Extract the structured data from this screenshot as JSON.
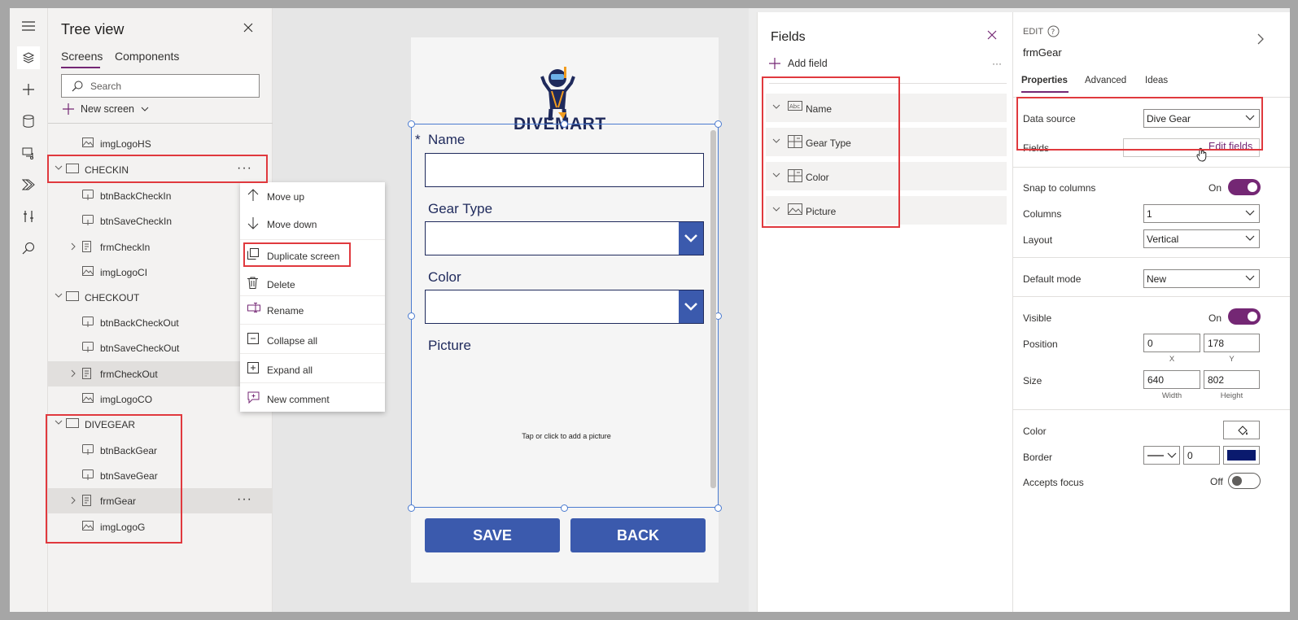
{
  "colors": {
    "accent": "#742774",
    "form_primary": "#3b5aad",
    "form_text": "#1f2a5c",
    "highlight": "#e0393e",
    "border_swatch": "#0a1a6e"
  },
  "tree": {
    "title": "Tree view",
    "tabs": [
      "Screens",
      "Components"
    ],
    "search_placeholder": "Search",
    "new_screen": "New screen",
    "nodes": [
      {
        "label": "imgLogoHS",
        "icon": "image-icon"
      },
      {
        "label": "CHECKIN",
        "icon": "screen-icon"
      },
      {
        "label": "btnBackCheckIn",
        "icon": "button-icon"
      },
      {
        "label": "btnSaveCheckIn",
        "icon": "button-icon"
      },
      {
        "label": "frmCheckIn",
        "icon": "form-icon"
      },
      {
        "label": "imgLogoCI",
        "icon": "image-icon"
      },
      {
        "label": "CHECKOUT",
        "icon": "screen-icon"
      },
      {
        "label": "btnBackCheckOut",
        "icon": "button-icon"
      },
      {
        "label": "btnSaveCheckOut",
        "icon": "button-icon"
      },
      {
        "label": "frmCheckOut",
        "icon": "form-icon"
      },
      {
        "label": "imgLogoCO",
        "icon": "image-icon"
      },
      {
        "label": "DIVEGEAR",
        "icon": "screen-icon"
      },
      {
        "label": "btnBackGear",
        "icon": "button-icon"
      },
      {
        "label": "btnSaveGear",
        "icon": "button-icon"
      },
      {
        "label": "frmGear",
        "icon": "form-icon"
      },
      {
        "label": "imgLogoG",
        "icon": "image-icon"
      }
    ],
    "more": "···"
  },
  "context_menu": {
    "items": [
      "Move up",
      "Move down",
      "Duplicate screen",
      "Delete",
      "Rename",
      "Collapse all",
      "Expand all",
      "New comment"
    ]
  },
  "canvas": {
    "logo_text": "DIVEMART",
    "required_mark": "*",
    "labels": {
      "name": "Name",
      "gear_type": "Gear Type",
      "color": "Color",
      "picture": "Picture"
    },
    "picture_hint": "Tap or click to add a picture",
    "save": "SAVE",
    "back": "BACK"
  },
  "fields": {
    "title": "Fields",
    "add_field": "Add field",
    "more": "···",
    "items": [
      {
        "label": "Name",
        "icon": "text-icon"
      },
      {
        "label": "Gear Type",
        "icon": "dropdown-field-icon"
      },
      {
        "label": "Color",
        "icon": "dropdown-field-icon"
      },
      {
        "label": "Picture",
        "icon": "image-icon"
      }
    ]
  },
  "props": {
    "edit": "EDIT",
    "name": "frmGear",
    "tabs": [
      "Properties",
      "Advanced",
      "Ideas"
    ],
    "data_source_label": "Data source",
    "data_source_value": "Dive Gear",
    "fields_label": "Fields",
    "edit_fields": "Edit fields",
    "snap_label": "Snap to columns",
    "snap_value": "On",
    "columns_label": "Columns",
    "columns_value": "1",
    "layout_label": "Layout",
    "layout_value": "Vertical",
    "default_mode_label": "Default mode",
    "default_mode_value": "New",
    "visible_label": "Visible",
    "visible_value": "On",
    "position_label": "Position",
    "position_x": "0",
    "position_y": "178",
    "x_caption": "X",
    "y_caption": "Y",
    "size_label": "Size",
    "size_w": "640",
    "size_h": "802",
    "w_caption": "Width",
    "h_caption": "Height",
    "color_label": "Color",
    "border_label": "Border",
    "border_width": "0",
    "accepts_focus_label": "Accepts focus",
    "accepts_focus_value": "Off"
  }
}
